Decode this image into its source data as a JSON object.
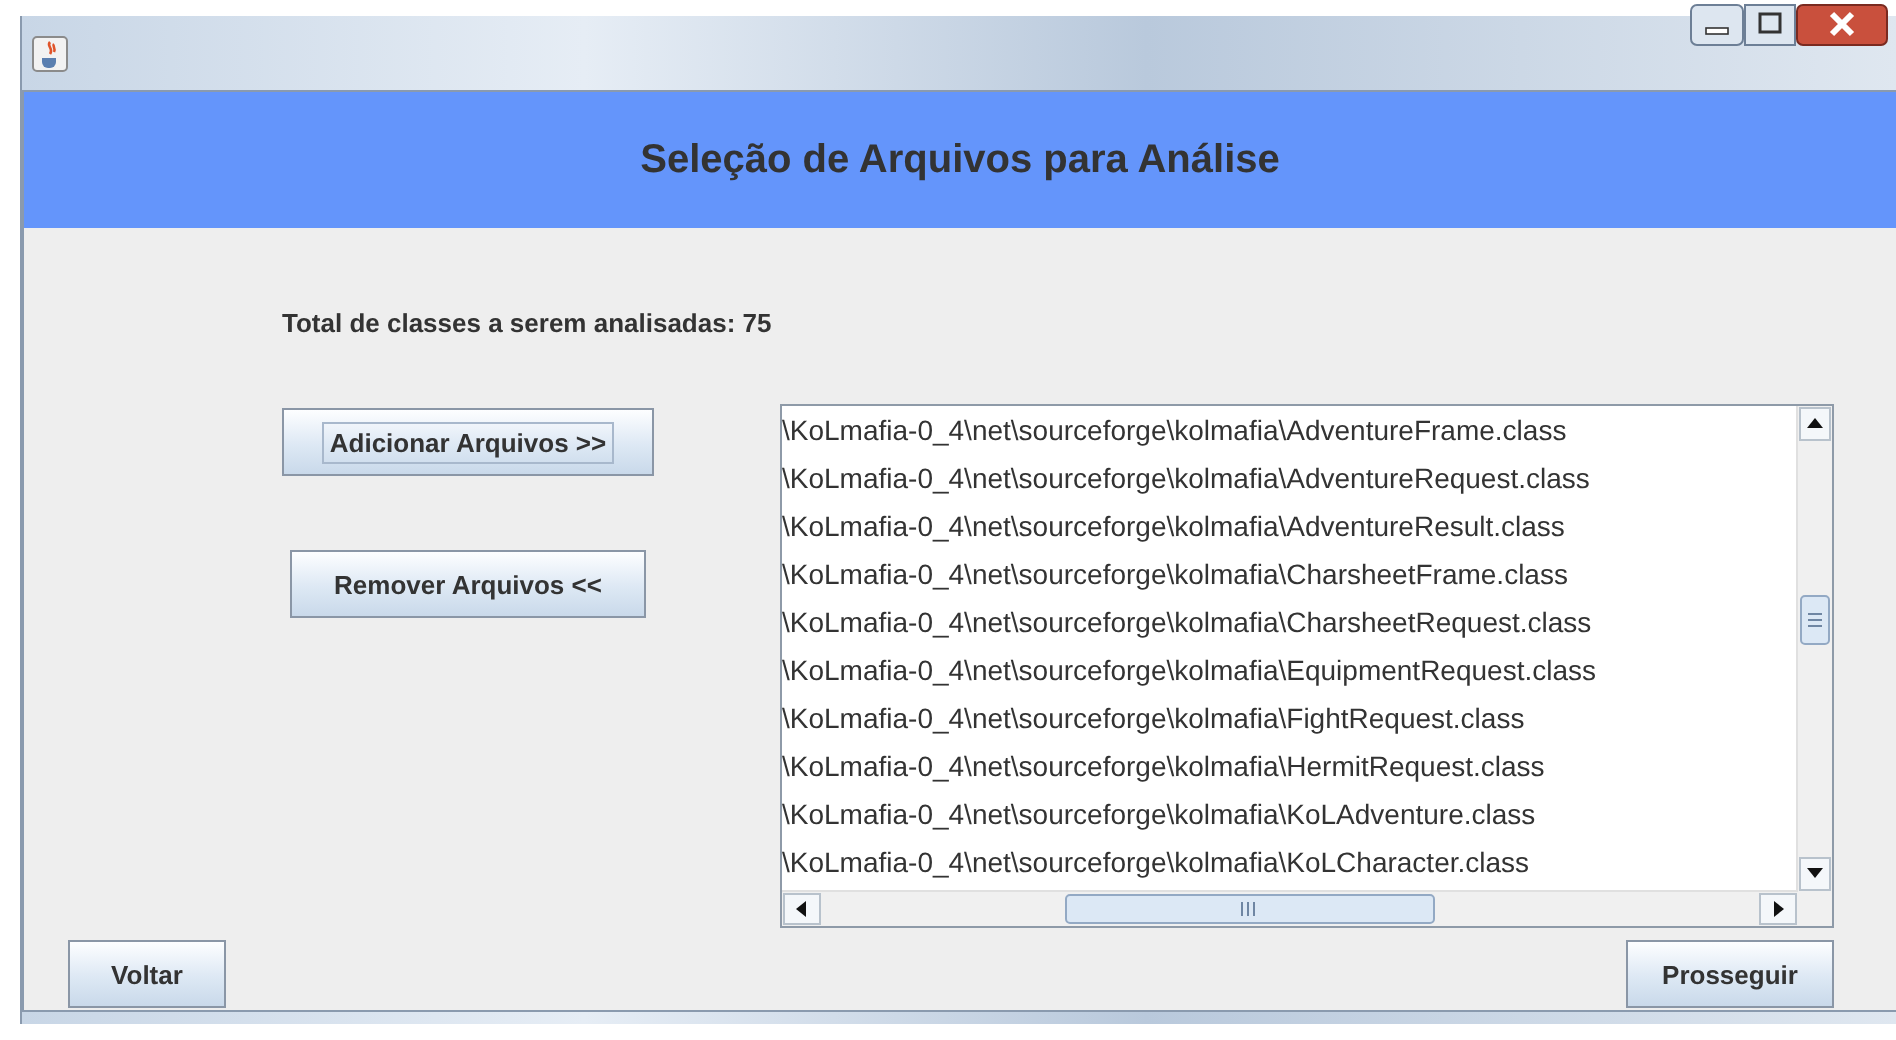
{
  "header": {
    "title": "Seleção de Arquivos para Análise"
  },
  "summary": "Total de classes a serem analisadas: 75",
  "side_buttons": [
    {
      "label": "Adicionar Arquivos >>",
      "focused": true
    },
    {
      "label": "Remover Arquivos <<",
      "focused": false
    }
  ],
  "file_list": {
    "items": [
      "\\KoLmafia-0_4\\net\\sourceforge\\kolmafia\\AdventureFrame.class",
      "\\KoLmafia-0_4\\net\\sourceforge\\kolmafia\\AdventureRequest.class",
      "\\KoLmafia-0_4\\net\\sourceforge\\kolmafia\\AdventureResult.class",
      "\\KoLmafia-0_4\\net\\sourceforge\\kolmafia\\CharsheetFrame.class",
      "\\KoLmafia-0_4\\net\\sourceforge\\kolmafia\\CharsheetRequest.class",
      "\\KoLmafia-0_4\\net\\sourceforge\\kolmafia\\EquipmentRequest.class",
      "\\KoLmafia-0_4\\net\\sourceforge\\kolmafia\\FightRequest.class",
      "\\KoLmafia-0_4\\net\\sourceforge\\kolmafia\\HermitRequest.class",
      "\\KoLmafia-0_4\\net\\sourceforge\\kolmafia\\KoLAdventure.class",
      "\\KoLmafia-0_4\\net\\sourceforge\\kolmafia\\KoLCharacter.class"
    ]
  },
  "footer_buttons": [
    {
      "label": "Voltar"
    },
    {
      "label": "Prosseguir"
    }
  ]
}
